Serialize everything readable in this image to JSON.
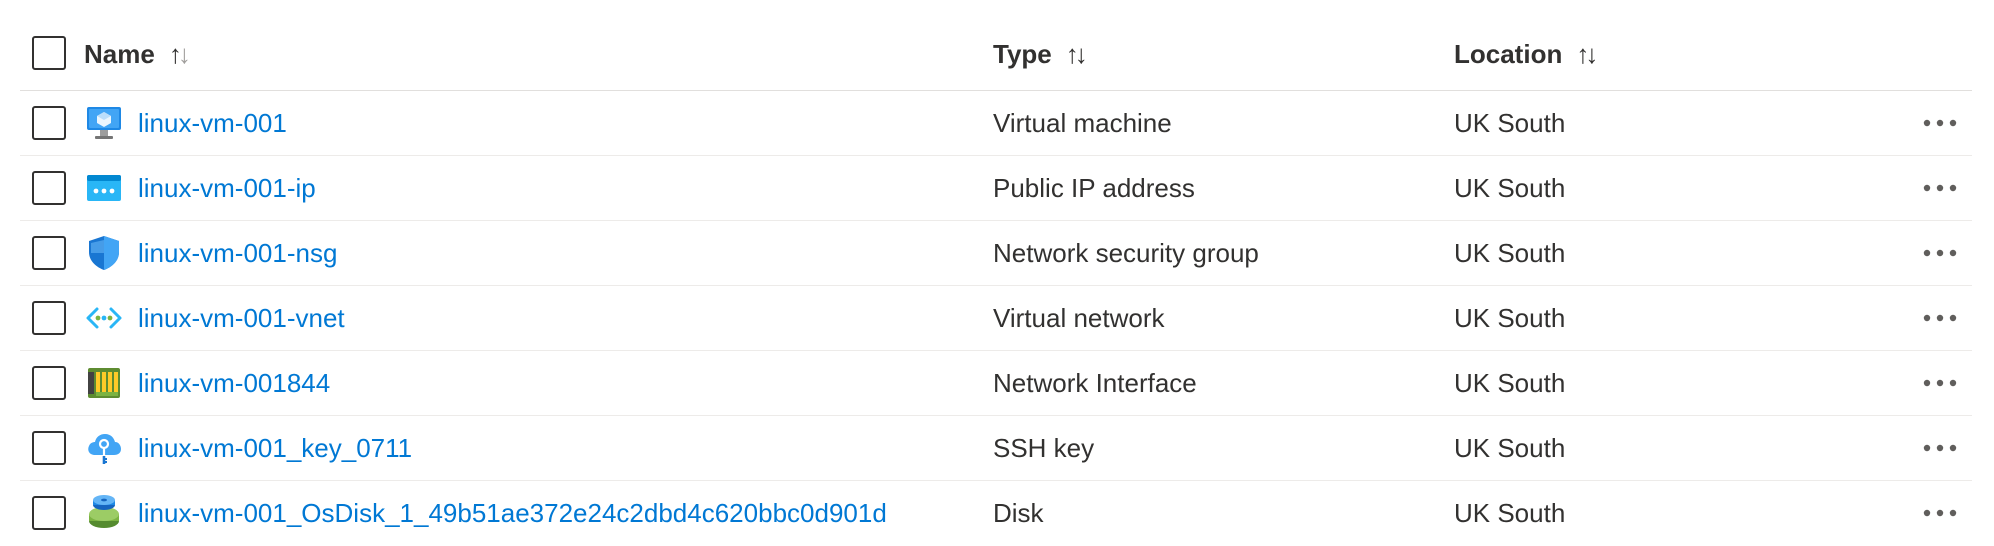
{
  "columns": {
    "name": "Name",
    "type": "Type",
    "location": "Location"
  },
  "sort_icon": "sort-up-down-icon",
  "rows": [
    {
      "name": "linux-vm-001",
      "type": "Virtual machine",
      "location": "UK South",
      "icon": "virtual-machine-icon"
    },
    {
      "name": "linux-vm-001-ip",
      "type": "Public IP address",
      "location": "UK South",
      "icon": "public-ip-icon"
    },
    {
      "name": "linux-vm-001-nsg",
      "type": "Network security group",
      "location": "UK South",
      "icon": "shield-icon"
    },
    {
      "name": "linux-vm-001-vnet",
      "type": "Virtual network",
      "location": "UK South",
      "icon": "virtual-network-icon"
    },
    {
      "name": "linux-vm-001844",
      "type": "Network Interface",
      "location": "UK South",
      "icon": "network-interface-icon"
    },
    {
      "name": "linux-vm-001_key_0711",
      "type": "SSH key",
      "location": "UK South",
      "icon": "ssh-key-icon"
    },
    {
      "name": "linux-vm-001_OsDisk_1_49b51ae372e24c2dbd4c620bbc0d901d",
      "type": "Disk",
      "location": "UK South",
      "icon": "disk-icon"
    }
  ],
  "colors": {
    "link": "#0078d4",
    "text": "#323130",
    "divider": "#edebe9"
  }
}
